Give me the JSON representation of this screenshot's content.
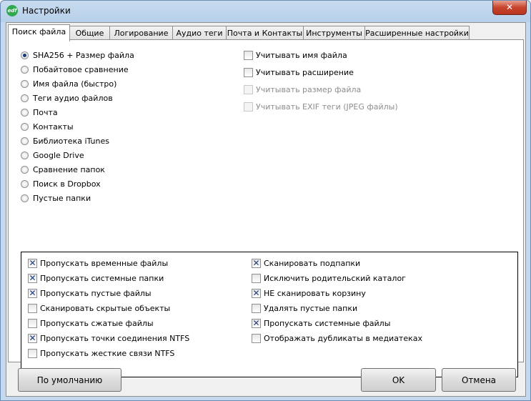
{
  "window": {
    "title": "Настройки",
    "app_icon_text": "edf",
    "close_symbol": "✕"
  },
  "tabs": [
    {
      "label": "Поиск файла",
      "active": true
    },
    {
      "label": "Общие"
    },
    {
      "label": "Логирование"
    },
    {
      "label": "Аудио теги"
    },
    {
      "label": "Почта и Контакты"
    },
    {
      "label": "Инструменты"
    },
    {
      "label": "Расширенные настройки"
    }
  ],
  "search_methods": [
    {
      "label": "SHA256 + Размер файла",
      "checked": true
    },
    {
      "label": "Побайтовое сравнение"
    },
    {
      "label": "Имя файла (быстро)"
    },
    {
      "label": "Теги аудио файлов"
    },
    {
      "label": "Почта"
    },
    {
      "label": "Контакты"
    },
    {
      "label": "Библиотека iTunes"
    },
    {
      "label": "Google Drive"
    },
    {
      "label": "Сравнение папок"
    },
    {
      "label": "Поиск в Dropbox"
    },
    {
      "label": "Пустые папки"
    }
  ],
  "match_options": [
    {
      "label": "Учитывать имя файла",
      "checked": false,
      "enabled": true
    },
    {
      "label": "Учитывать расширение",
      "checked": false,
      "enabled": true
    },
    {
      "label": "Учитывать размер файла",
      "checked": false,
      "enabled": false
    },
    {
      "label": "Учитывать EXIF теги (JPEG файлы)",
      "checked": false,
      "enabled": false
    }
  ],
  "scan_options_left": [
    {
      "label": "Пропускать временные файлы",
      "checked": true
    },
    {
      "label": "Пропускать системные папки",
      "checked": true
    },
    {
      "label": "Пропускать пустые файлы",
      "checked": true
    },
    {
      "label": "Сканировать скрытые объекты",
      "checked": false
    },
    {
      "label": "Пропускать сжатые файлы",
      "checked": false
    },
    {
      "label": "Пропускать точки соединения NTFS",
      "checked": true
    },
    {
      "label": "Пропускать жесткие связи NTFS",
      "checked": false
    }
  ],
  "scan_options_right": [
    {
      "label": "Сканировать подпапки",
      "checked": true
    },
    {
      "label": "Исключить родительский каталог",
      "checked": false
    },
    {
      "label": "НЕ сканировать корзину",
      "checked": true
    },
    {
      "label": "Удалять пустые папки",
      "checked": false
    },
    {
      "label": "Пропускать системные файлы",
      "checked": true
    },
    {
      "label": "Отображать дубликаты в медиатеках",
      "checked": false
    }
  ],
  "buttons": {
    "defaults": "По умолчанию",
    "ok": "OK",
    "cancel": "Отмена"
  },
  "colors": {
    "check_mark": "#1f3d7a",
    "close_button": "#c7442d",
    "app_icon": "#2fa84f"
  }
}
